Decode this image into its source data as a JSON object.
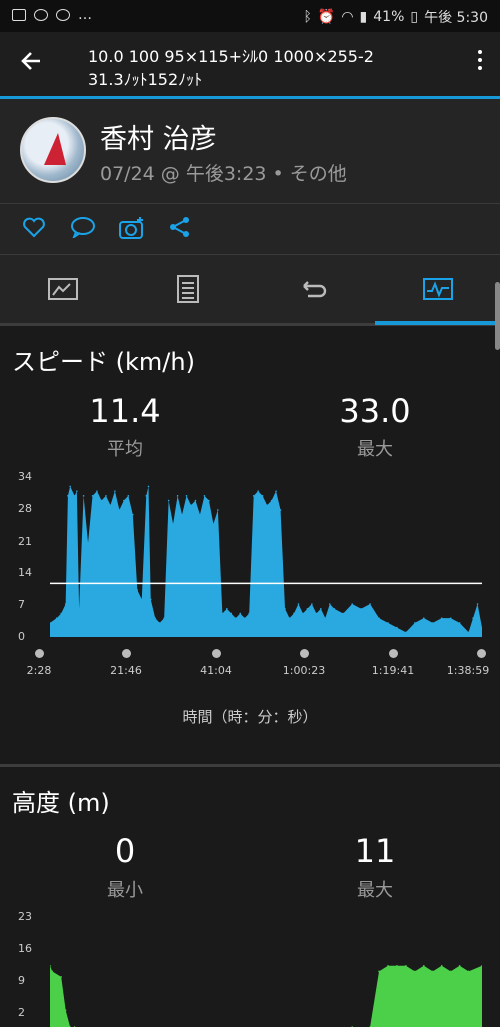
{
  "status_bar": {
    "time": "午後 5:30",
    "battery": "41%",
    "ellipsis": "…"
  },
  "app_bar": {
    "back_icon": "back-arrow-icon",
    "title_line1": "10.0 100 95×115+ｼﾙ0 1000×255-2",
    "title_line2": "31.3ﾉｯﾄ152ﾉｯﾄ"
  },
  "profile": {
    "name": "香村 治彦",
    "meta": "07/24 @ 午後3:23 • その他"
  },
  "actions": [
    "like-icon",
    "comment-icon",
    "add-photo-icon",
    "share-icon"
  ],
  "tabs": [
    {
      "name": "summary",
      "icon": "summary-icon"
    },
    {
      "name": "details",
      "icon": "details-icon"
    },
    {
      "name": "laps",
      "icon": "laps-icon"
    },
    {
      "name": "charts",
      "icon": "chart-icon",
      "active": true
    }
  ],
  "speed": {
    "title": "スピード (km/h)",
    "avg_value": "11.4",
    "avg_label": "平均",
    "max_value": "33.0",
    "max_label": "最大"
  },
  "altitude": {
    "title": "高度 (m)",
    "min_value": "0",
    "min_label": "最小",
    "max_value": "11",
    "max_label": "最大"
  },
  "colors": {
    "accent": "#1798d8",
    "speed_fill": "#2aa9e0",
    "alt_fill": "#4cd04a"
  },
  "chart_data": [
    {
      "type": "area",
      "title": "スピード (km/h)",
      "xlabel": "時間（時：分：秒）",
      "y_ticks": [
        "34",
        "28",
        "21",
        "14",
        "7",
        "0"
      ],
      "x_ticks": [
        "2:28",
        "21:46",
        "41:04",
        "1:00:23",
        "1:19:41",
        "1:38:59"
      ],
      "ylim": [
        0,
        34
      ],
      "x_minutes": [
        2.5,
        4,
        5,
        6,
        6.5,
        7,
        8,
        8.5,
        9,
        10,
        11,
        12,
        13,
        14,
        15,
        16,
        17,
        18,
        19,
        20,
        21,
        22,
        23,
        24,
        24.5,
        25,
        26,
        27,
        28,
        29,
        30,
        31,
        32,
        33,
        34,
        35,
        36,
        37,
        38,
        39,
        40,
        41,
        42,
        43,
        44,
        45,
        46,
        47,
        48,
        49,
        50,
        51,
        52,
        53,
        54,
        55,
        56,
        57,
        58,
        59,
        60,
        61,
        62,
        63,
        64,
        65,
        66,
        68,
        70,
        72,
        74,
        76,
        78,
        80,
        82,
        84,
        86,
        88,
        90,
        92,
        94,
        96,
        97,
        98,
        99
      ],
      "values": [
        3,
        4,
        5,
        7,
        30,
        32,
        30,
        31,
        6,
        30,
        20,
        30,
        31,
        29,
        30,
        28,
        31,
        27,
        29,
        30,
        26,
        10,
        8,
        30,
        32,
        8,
        4,
        3,
        4,
        29,
        24,
        30,
        26,
        30,
        28,
        29,
        26,
        30,
        29,
        24,
        27,
        5,
        6,
        5,
        4,
        5,
        4,
        5,
        30,
        31,
        30,
        28,
        29,
        31,
        27,
        6,
        4,
        5,
        7,
        5,
        6,
        7,
        5,
        6,
        4,
        7,
        6,
        5,
        7,
        6,
        7,
        4,
        3,
        2,
        1,
        3,
        4,
        3,
        4,
        4,
        3,
        1,
        4,
        7,
        2
      ],
      "reference_line": 11.4
    },
    {
      "type": "area",
      "title": "高度 (m)",
      "y_ticks": [
        "23",
        "16",
        "9",
        "2"
      ],
      "values_note": "",
      "x_minutes": [
        2.5,
        3,
        5,
        6,
        7,
        8,
        70,
        74,
        76,
        78,
        80,
        82,
        84,
        86,
        88,
        90,
        92,
        94,
        96,
        99
      ],
      "values": [
        11,
        10,
        9,
        3,
        0,
        0,
        0,
        0,
        10,
        11,
        11,
        11,
        10,
        11,
        10,
        11,
        10,
        11,
        10,
        11
      ],
      "ylim": [
        0,
        23
      ]
    }
  ]
}
